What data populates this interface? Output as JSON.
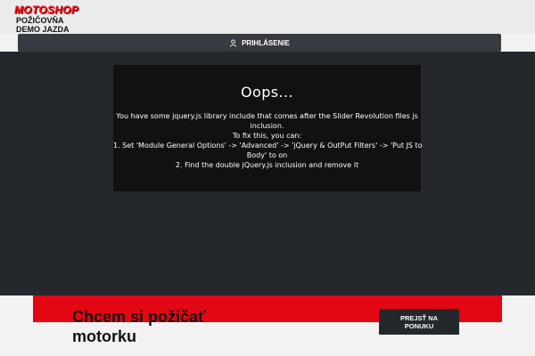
{
  "header": {
    "logo_text": "MOTOSHOP",
    "nav": [
      "POŽIČOVŇA",
      "DEMO JAZDA"
    ]
  },
  "login": {
    "label": "PRIHLÁSENIE",
    "icon": "user-icon"
  },
  "error": {
    "title": "Oops...",
    "lines": [
      "You have some jquery.js library include that comes after the Slider Revolution files js",
      "inclusion.",
      "To fix this, you can:",
      "1. Set 'Module General Options' -> 'Advanced' -> 'jQuery & OutPut Filters' -> 'Put JS to",
      "Body' to on",
      "2. Find the double jQuery.js inclusion and remove it"
    ]
  },
  "cta": {
    "title_line1": "Chcem si požičať",
    "title_line2": "motorku",
    "button_line1": "PREJSŤ NA",
    "button_line2": "PONUKU"
  },
  "colors": {
    "brand_red": "#e30613",
    "dark": "#24282c",
    "bar": "#373b41"
  }
}
